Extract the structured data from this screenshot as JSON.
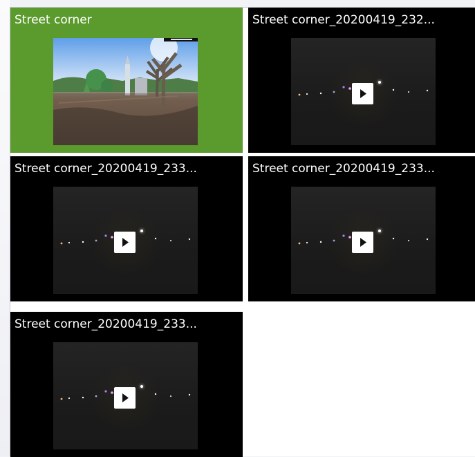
{
  "grid": {
    "tiles": [
      {
        "title": "Street corner",
        "selected": true,
        "thumbnail": "photo"
      },
      {
        "title": "Street corner_20200419_232...",
        "selected": false,
        "thumbnail": "video"
      },
      {
        "title": "Street corner_20200419_233...",
        "selected": false,
        "thumbnail": "video"
      },
      {
        "title": "Street corner_20200419_233...",
        "selected": false,
        "thumbnail": "video"
      },
      {
        "title": "Street corner_20200419_233...",
        "selected": false,
        "thumbnail": "video"
      }
    ]
  },
  "icons": {
    "play": "play-icon"
  },
  "colors": {
    "selected_tile": "#5b9a2c",
    "tile_background": "#000000",
    "text": "#ffffff"
  }
}
